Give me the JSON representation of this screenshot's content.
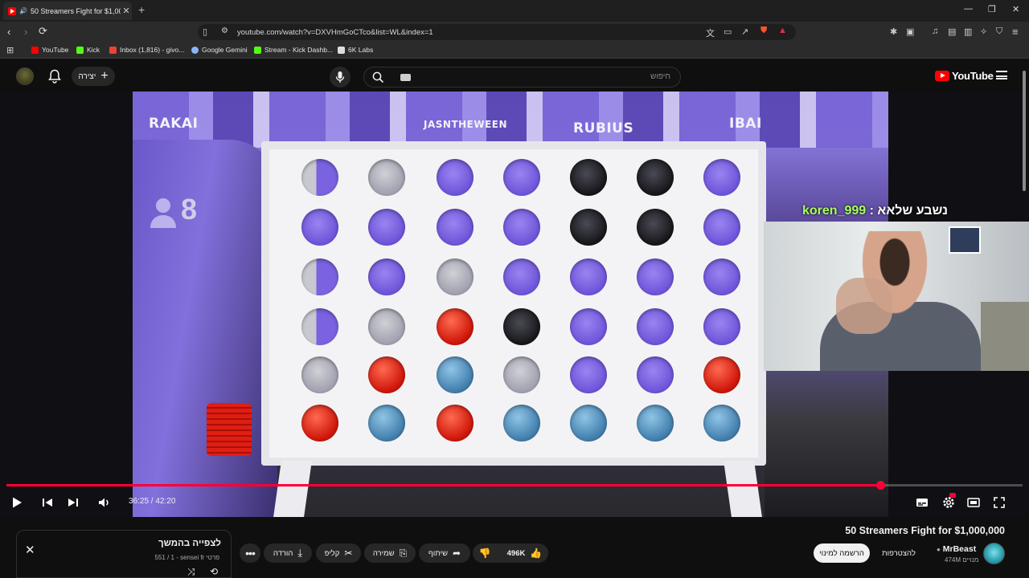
{
  "browser": {
    "tab_title": "50 Streamers Fight for $1,000...",
    "url": "youtube.com/watch?v=DXVHmGoCTco&list=WL&index=1",
    "bookmarks": [
      {
        "label": "YouTube",
        "color": "#ff0000"
      },
      {
        "label": "Kick",
        "color": "#53fc18"
      },
      {
        "label": "Inbox (1,816) - givo...",
        "color": "#ea4335"
      },
      {
        "label": "Google Gemini",
        "color": "#8ab4f8"
      },
      {
        "label": "Stream - Kick Dashb...",
        "color": "#53fc18"
      },
      {
        "label": "6K Labs",
        "color": "#ffffff"
      }
    ]
  },
  "header": {
    "create_label": "יצירה",
    "search_placeholder": "חיפוש",
    "logo_text": "YouTube"
  },
  "player": {
    "chat_user": "koren_999",
    "chat_message": ": נשבע שלאא",
    "jersey_names": [
      "RAKAI",
      "JASNTHEWEEN",
      "RUBIUS",
      "IBAI"
    ],
    "viewer_count": "8",
    "current_time": "36:25",
    "duration": "42:20",
    "progress": 0.86,
    "board": [
      [
        "mix",
        "grey",
        "purple",
        "purple",
        "dark",
        "dark",
        "purple"
      ],
      [
        "purple",
        "purple",
        "purple",
        "purple",
        "dark",
        "dark",
        "purple"
      ],
      [
        "mix",
        "purple",
        "grey",
        "purple",
        "purple",
        "purple",
        "purple"
      ],
      [
        "mix",
        "grey",
        "red",
        "dark",
        "purple",
        "purple",
        "purple"
      ],
      [
        "grey",
        "red",
        "blue",
        "grey",
        "purple",
        "purple",
        "red"
      ],
      [
        "red",
        "blue",
        "red",
        "blue",
        "blue",
        "blue",
        "blue"
      ]
    ],
    "colors": {
      "accent": "#ff0033",
      "chat_user": "#a6ff5a"
    }
  },
  "video": {
    "title": "50 Streamers Fight for $1,000,000",
    "channel": "MrBeast",
    "subscribers": "474M מנויים",
    "subscribe_label": "להצטרפות",
    "subscribed_label": "הרשמה למינוי",
    "likes": "496K",
    "share_label": "שיתוף",
    "save_label": "שמירה",
    "clip_label": "קליפ",
    "download_label": "הורדה"
  },
  "watch_later": {
    "title": "לצפייה בהמשך",
    "subtitle": "551 / 1 - sensei fr פרטי"
  }
}
